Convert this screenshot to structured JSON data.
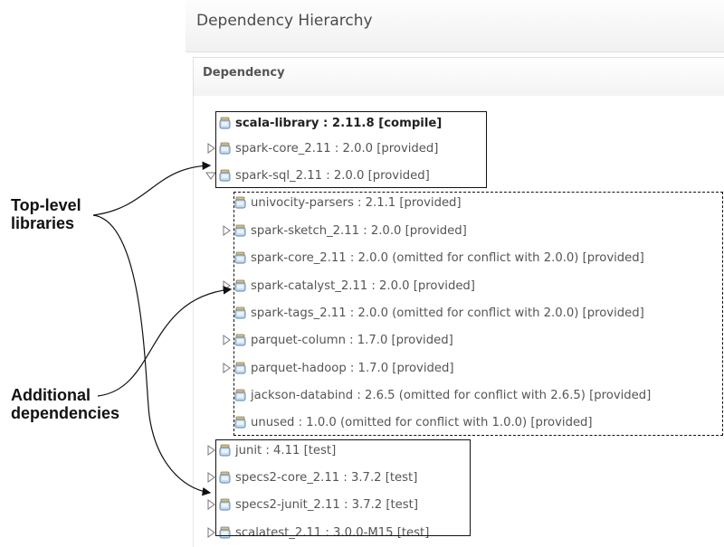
{
  "header": {
    "title": "Dependency Hierarchy"
  },
  "section": {
    "title": "Dependency"
  },
  "tree": [
    {
      "label": "scala-library : 2.11.8 [compile]",
      "indent": 0,
      "toggle": "none",
      "bold": true
    },
    {
      "label": "spark-core_2.11 : 2.0.0 [provided]",
      "indent": 0,
      "toggle": "collapsed"
    },
    {
      "label": "spark-sql_2.11 : 2.0.0 [provided]",
      "indent": 0,
      "toggle": "expanded"
    },
    {
      "label": "univocity-parsers : 2.1.1 [provided]",
      "indent": 1,
      "toggle": "none"
    },
    {
      "label": "spark-sketch_2.11 : 2.0.0 [provided]",
      "indent": 1,
      "toggle": "collapsed"
    },
    {
      "label": "spark-core_2.11 : 2.0.0 (omitted for conflict with 2.0.0) [provided]",
      "indent": 1,
      "toggle": "none"
    },
    {
      "label": "spark-catalyst_2.11 : 2.0.0 [provided]",
      "indent": 1,
      "toggle": "collapsed"
    },
    {
      "label": "spark-tags_2.11 : 2.0.0 (omitted for conflict with 2.0.0) [provided]",
      "indent": 1,
      "toggle": "none"
    },
    {
      "label": "parquet-column : 1.7.0 [provided]",
      "indent": 1,
      "toggle": "collapsed"
    },
    {
      "label": "parquet-hadoop : 1.7.0 [provided]",
      "indent": 1,
      "toggle": "collapsed"
    },
    {
      "label": "jackson-databind : 2.6.5 (omitted for conflict with 2.6.5) [provided]",
      "indent": 1,
      "toggle": "none"
    },
    {
      "label": "unused : 1.0.0 (omitted for conflict with 1.0.0) [provided]",
      "indent": 1,
      "toggle": "none"
    },
    {
      "label": "junit : 4.11 [test]",
      "indent": 0,
      "toggle": "collapsed"
    },
    {
      "label": "specs2-core_2.11 : 3.7.2 [test]",
      "indent": 0,
      "toggle": "collapsed"
    },
    {
      "label": "specs2-junit_2.11 : 3.7.2 [test]",
      "indent": 0,
      "toggle": "collapsed"
    },
    {
      "label": "scalatest_2.11 : 3.0.0-M15 [test]",
      "indent": 0,
      "toggle": "collapsed"
    }
  ],
  "annotations": {
    "top_level": "Top-level\nlibraries",
    "additional": "Additional\ndependencies"
  },
  "icons": {
    "collapsed": "triangle-right-icon",
    "expanded": "triangle-down-icon",
    "jar": "jar-icon"
  }
}
